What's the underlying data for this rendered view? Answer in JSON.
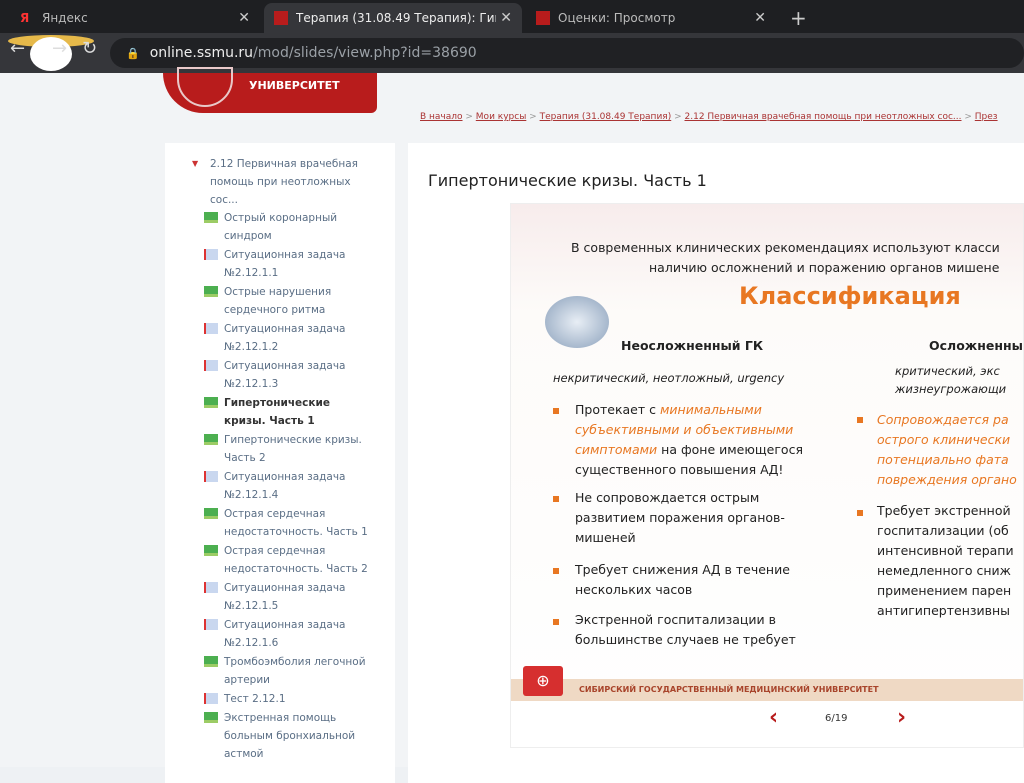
{
  "tabs": [
    {
      "label": "Яндекс"
    },
    {
      "label": "Терапия (31.08.49 Терапия): Гип"
    },
    {
      "label": "Оценки: Просмотр"
    }
  ],
  "address": {
    "host": "online.ssmu.ru",
    "path": "/mod/slides/view.php?id=38690"
  },
  "logo": {
    "text": "УНИВЕРСИТЕТ"
  },
  "breadcrumb": [
    "В начало",
    "Мои курсы",
    "Терапия (31.08.49 Терапия)",
    "2.12 Первичная врачебная помощь при неотложных сос...",
    "През"
  ],
  "sidebar": {
    "section": "2.12 Первичная врачебная помощь при неотложных сос...",
    "items": [
      {
        "label": "Острый коронарный синдром",
        "type": "slides"
      },
      {
        "label": "Ситуационная задача №2.12.1.1",
        "type": "task"
      },
      {
        "label": "Острые нарушения сердечного ритма",
        "type": "slides"
      },
      {
        "label": "Ситуационная задача №2.12.1.2",
        "type": "task"
      },
      {
        "label": "Ситуационная задача №2.12.1.3",
        "type": "task"
      },
      {
        "label": "Гипертонические кризы. Часть 1",
        "type": "slides"
      },
      {
        "label": "Гипертонические кризы. Часть 2",
        "type": "slides"
      },
      {
        "label": "Ситуационная задача №2.12.1.4",
        "type": "task"
      },
      {
        "label": "Острая сердечная недостаточность. Часть 1",
        "type": "slides"
      },
      {
        "label": "Острая сердечная недостаточность. Часть 2",
        "type": "slides"
      },
      {
        "label": "Ситуационная задача №2.12.1.5",
        "type": "task"
      },
      {
        "label": "Ситуационная задача №2.12.1.6",
        "type": "task"
      },
      {
        "label": "Тромбоэмболия легочной артерии",
        "type": "slides"
      },
      {
        "label": "Тест 2.12.1",
        "type": "task"
      },
      {
        "label": "Экстренная помощь больным бронхиальной астмой",
        "type": "slides"
      }
    ]
  },
  "main": {
    "title": "Гипертонические кризы. Часть 1"
  },
  "slide": {
    "intro1": "В современных клинических рекомендациях используют класси",
    "intro2": "наличию осложнений и поражению органов мишене",
    "heading": "Классификация",
    "left_title": "Неосложненный ГК",
    "left_sub": "некритический, неотложный, urgency",
    "b1a": "Протекает с ",
    "b1b": "минимальными",
    "b1c": "субъективными и объективными",
    "b1d": "симптомами",
    "b1e": " на фоне имеющегося",
    "b1f": "существенного повышения АД!",
    "b2": [
      "Не сопровождается острым",
      "развитием поражения органов-",
      "мишеней"
    ],
    "b3": [
      "Требует снижения АД в течение",
      "нескольких часов"
    ],
    "b4": [
      "Экстренной госпитализации в",
      "большинстве случаев не требует"
    ],
    "right_title": "Осложненны",
    "right_sub": [
      "критический, экс",
      "жизнеугрожающи"
    ],
    "r1": [
      "Сопровождается ра",
      "острого клинически",
      "потенциально фата",
      "повреждения органо"
    ],
    "r2": [
      "Требует экстренной",
      "госпитализации (об",
      "интенсивной терапи",
      "немедленного сниж",
      "применением парен",
      "антигипертензивны"
    ],
    "footer": "СИБИРСКИЙ ГОСУДАРСТВЕННЫЙ МЕДИЦИНСКИЙ УНИВЕРСИТЕТ"
  },
  "pager": {
    "current": "6/19",
    "prev": "‹",
    "next": "›"
  }
}
